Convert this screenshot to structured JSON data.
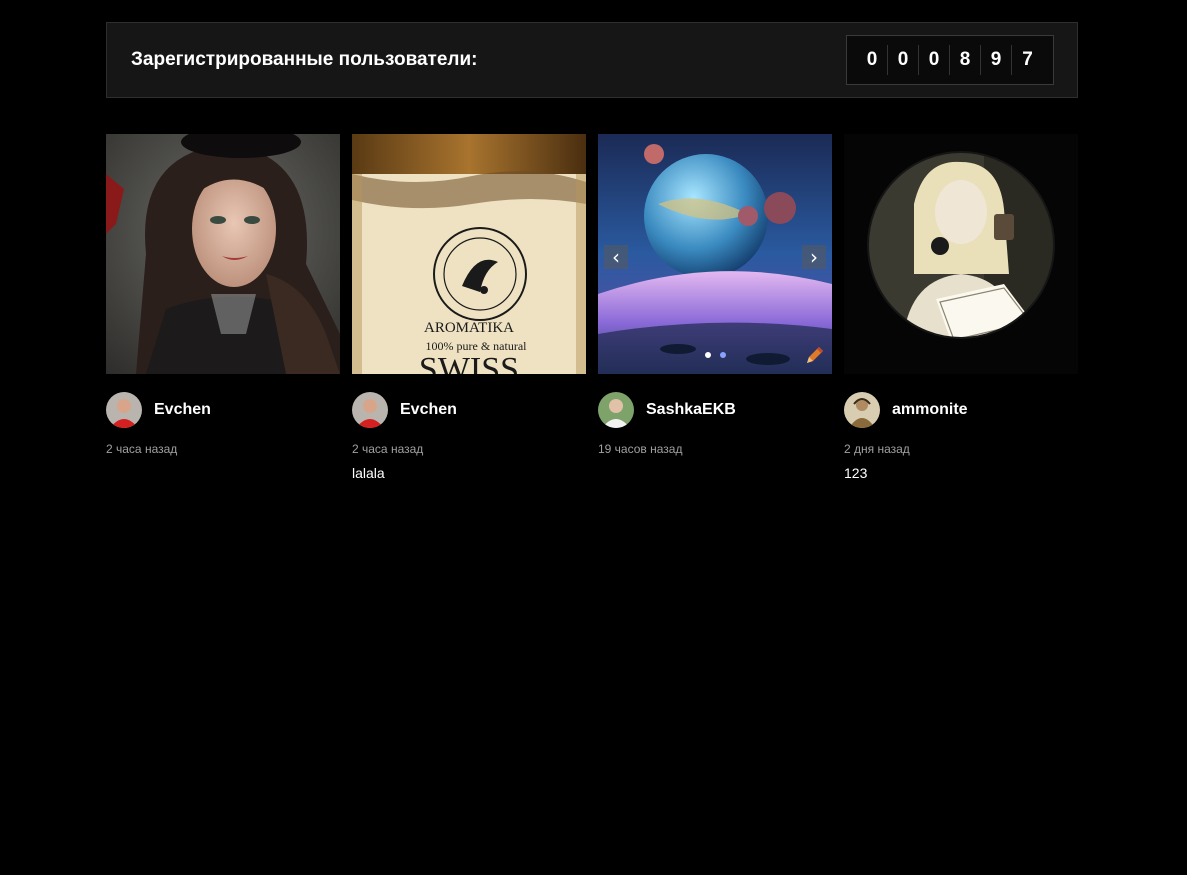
{
  "stats": {
    "label": "Зарегистрированные пользователи:",
    "digits": [
      "0",
      "0",
      "0",
      "8",
      "9",
      "7"
    ]
  },
  "cards": [
    {
      "image": "portrait-woman-in-hat",
      "author": "Evchen",
      "time": "2 часа назад",
      "caption": ""
    },
    {
      "image": "aromatika-oil-bottle",
      "author": "Evchen",
      "time": "2 часа назад",
      "caption": "lalala"
    },
    {
      "image": "space-planet-landscape",
      "author": "SashkaEKB",
      "time": "19 часов назад",
      "caption": "",
      "carousel": {
        "prev_icon": "‹",
        "next_icon": "›",
        "slides": 2,
        "active_slide": 1
      }
    },
    {
      "image": "woman-with-coffee-circle",
      "author": "ammonite",
      "time": "2 дня назад",
      "caption": "123"
    }
  ],
  "bottle_text": {
    "brand": "AROMATIKA",
    "tagline": "100% pure & natural",
    "word": "SWISS"
  },
  "colors": {
    "background": "#000000",
    "panel": "#161616",
    "muted_text": "#a0a0a0",
    "dot_inactive": "#8aa2ff"
  }
}
